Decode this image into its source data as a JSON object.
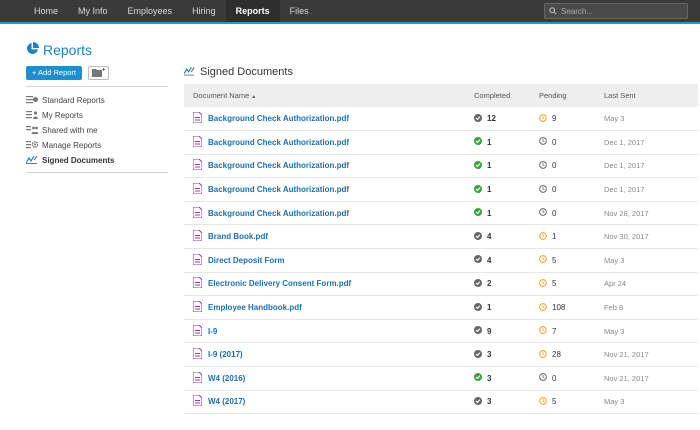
{
  "nav": {
    "items": [
      "Home",
      "My Info",
      "Employees",
      "Hiring",
      "Reports",
      "Files"
    ],
    "active": "Reports",
    "search_placeholder": "Search..."
  },
  "sidebar": {
    "title": "Reports",
    "add_label": "+ Add Report",
    "items": [
      "Standard Reports",
      "My Reports",
      "Shared with me",
      "Manage Reports",
      "Signed Documents"
    ],
    "active": "Signed Documents"
  },
  "main": {
    "title": "Signed Documents",
    "columns": [
      "Document Name",
      "Completed",
      "Pending",
      "Last Sent"
    ],
    "rows": [
      {
        "name": "Background Check Authorization.pdf",
        "completed": "12",
        "completed_status": "gray",
        "pending": "9",
        "pending_status": "orange",
        "last_sent": "May 3"
      },
      {
        "name": "Background Check Authorization.pdf",
        "completed": "1",
        "completed_status": "green",
        "pending": "0",
        "pending_status": "gray",
        "last_sent": "Dec 1, 2017"
      },
      {
        "name": "Background Check Authorization.pdf",
        "completed": "1",
        "completed_status": "green",
        "pending": "0",
        "pending_status": "gray",
        "last_sent": "Dec 1, 2017"
      },
      {
        "name": "Background Check Authorization.pdf",
        "completed": "1",
        "completed_status": "green",
        "pending": "0",
        "pending_status": "gray",
        "last_sent": "Dec 1, 2017"
      },
      {
        "name": "Background Check Authorization.pdf",
        "completed": "1",
        "completed_status": "green",
        "pending": "0",
        "pending_status": "gray",
        "last_sent": "Nov 28, 2017"
      },
      {
        "name": "Brand Book.pdf",
        "completed": "4",
        "completed_status": "gray",
        "pending": "1",
        "pending_status": "orange",
        "last_sent": "Nov 30, 2017"
      },
      {
        "name": "Direct Deposit Form",
        "completed": "4",
        "completed_status": "gray",
        "pending": "5",
        "pending_status": "orange",
        "last_sent": "May 3"
      },
      {
        "name": "Electronic Delivery Consent Form.pdf",
        "completed": "2",
        "completed_status": "gray",
        "pending": "5",
        "pending_status": "orange",
        "last_sent": "Apr 24"
      },
      {
        "name": "Employee Handbook.pdf",
        "completed": "1",
        "completed_status": "gray",
        "pending": "108",
        "pending_status": "orange",
        "last_sent": "Feb 8"
      },
      {
        "name": "I-9",
        "completed": "9",
        "completed_status": "gray",
        "pending": "7",
        "pending_status": "orange",
        "last_sent": "May 3"
      },
      {
        "name": "I-9 (2017)",
        "completed": "3",
        "completed_status": "gray",
        "pending": "28",
        "pending_status": "orange",
        "last_sent": "Nov 21, 2017"
      },
      {
        "name": "W4 (2016)",
        "completed": "3",
        "completed_status": "green",
        "pending": "0",
        "pending_status": "gray",
        "last_sent": "Nov 21, 2017"
      },
      {
        "name": "W4 (2017)",
        "completed": "3",
        "completed_status": "gray",
        "pending": "5",
        "pending_status": "orange",
        "last_sent": "May 3"
      }
    ]
  },
  "colors": {
    "accent": "#1a9ad6",
    "link": "#1a6fb5",
    "green": "#3aa33a",
    "orange": "#f0a020",
    "gray": "#666666",
    "doc_icon": "#8a3f9a"
  }
}
